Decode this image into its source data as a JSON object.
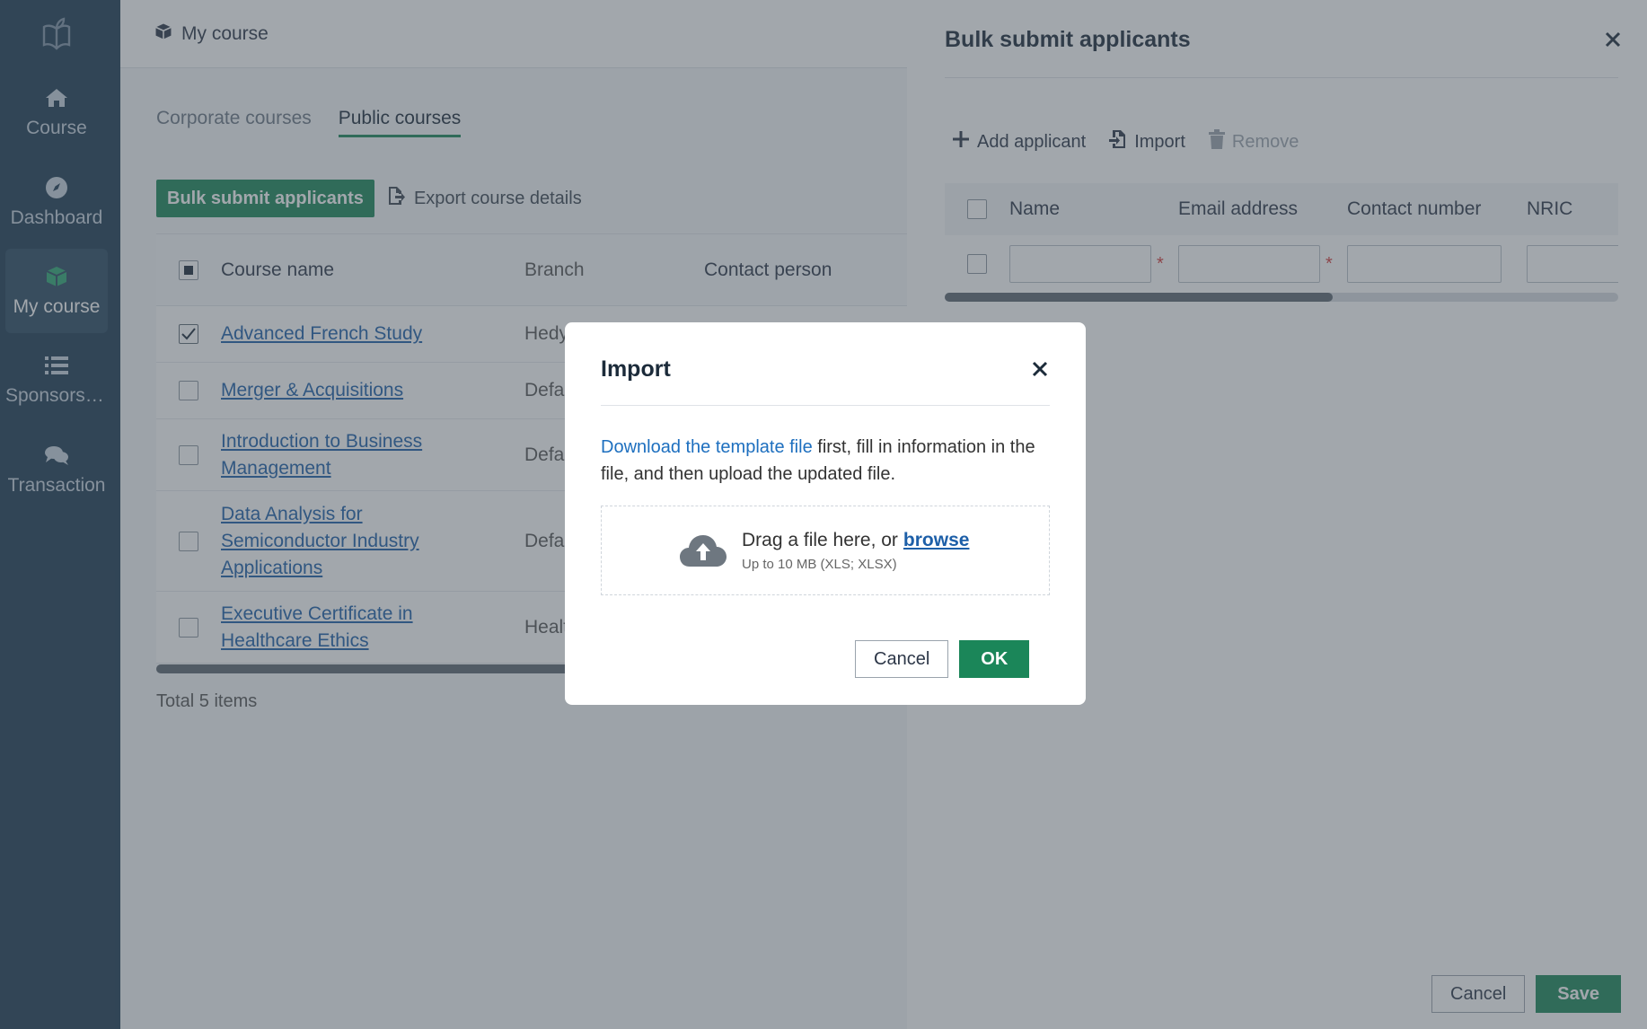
{
  "sidebar": {
    "items": [
      {
        "label": "Course",
        "icon": "home-icon"
      },
      {
        "label": "Dashboard",
        "icon": "compass-icon"
      },
      {
        "label": "My course",
        "icon": "cube-icon",
        "active": true
      },
      {
        "label": "Sponsorsh...",
        "icon": "list-icon"
      },
      {
        "label": "Transaction",
        "icon": "chat-dollar-icon"
      }
    ]
  },
  "header": {
    "title": "My course"
  },
  "tabs": [
    {
      "label": "Corporate courses"
    },
    {
      "label": "Public courses",
      "active": true
    }
  ],
  "toolbar": {
    "bulk_submit": "Bulk submit applicants",
    "export": "Export course details"
  },
  "table": {
    "columns": [
      "Course name",
      "Branch",
      "Contact person"
    ],
    "rows": [
      {
        "name_lines": [
          "Advanced French Study"
        ],
        "branch": "Hedy",
        "checked": true
      },
      {
        "name_lines": [
          "Merger & Acquisitions"
        ],
        "branch": "Defa",
        "checked": false
      },
      {
        "name_lines": [
          "Introduction to Business",
          "Management"
        ],
        "branch": "Defa",
        "checked": false
      },
      {
        "name_lines": [
          "Data Analysis for",
          "Semiconductor Industry",
          "Applications"
        ],
        "branch": "Defa",
        "checked": false
      },
      {
        "name_lines": [
          "Executive Certificate in",
          "Healthcare Ethics"
        ],
        "branch": "Healt",
        "checked": false
      }
    ],
    "total": "Total 5 items"
  },
  "drawer": {
    "title": "Bulk submit applicants",
    "toolbar": {
      "add": "Add applicant",
      "import": "Import",
      "remove": "Remove"
    },
    "columns": {
      "name": "Name",
      "email": "Email address",
      "contact": "Contact number",
      "nric": "NRIC"
    },
    "required_mark": "*",
    "footer": {
      "cancel": "Cancel",
      "save": "Save"
    }
  },
  "modal": {
    "title": "Import",
    "text_link": "Download the template file",
    "text_rest": " first, fill in information in the file, and then upload the updated file.",
    "drop_text": "Drag a file here, or",
    "browse": "browse",
    "drop_hint": "Up to 10 MB (XLS; XLSX)",
    "cancel": "Cancel",
    "ok": "OK"
  },
  "colors": {
    "sidebar_bg": "#1d3a52",
    "primary_green": "#1b8659",
    "link_blue": "#1d5fa8",
    "required_red": "#d23c3c"
  }
}
